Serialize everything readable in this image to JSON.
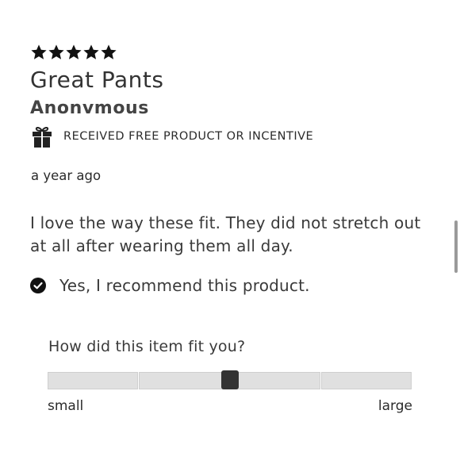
{
  "review": {
    "rating": 5,
    "rating_max": 5,
    "title": "Great Pants",
    "author": "Anonvmous",
    "incentive_label": "RECEIVED FREE PRODUCT OR INCENTIVE",
    "date": "a year ago",
    "body": "I love the way these fit. They did not stretch out at all after wearing them all day.",
    "recommend_label": "Yes, I recommend this product."
  },
  "fit": {
    "question": "How did this item fit you?",
    "min_label": "small",
    "max_label": "large",
    "value_fraction": 0.5,
    "segments": 4
  },
  "icons": {
    "star": "star-icon",
    "gift": "gift-icon",
    "check": "check-circle-icon"
  },
  "colors": {
    "text": "#2b2b2b",
    "star": "#111111",
    "track": "#e0e0e0",
    "handle": "#333333"
  }
}
